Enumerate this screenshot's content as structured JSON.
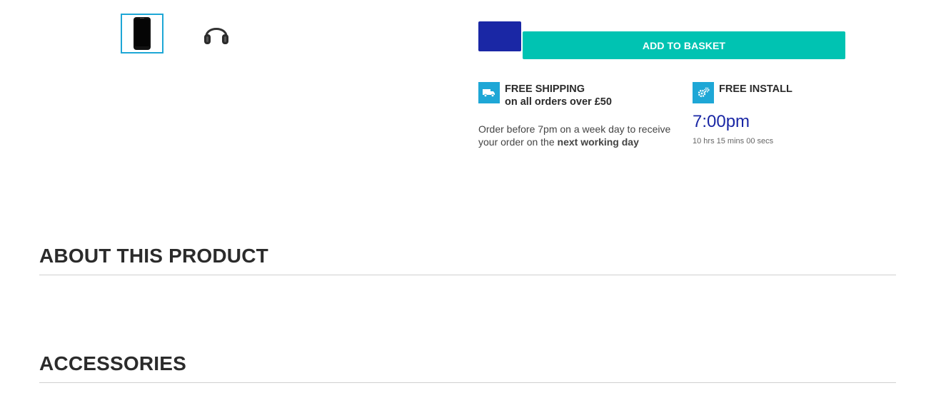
{
  "actions": {
    "add_to_basket_label": "ADD TO BASKET"
  },
  "shipping": {
    "title": "FREE SHIPPING",
    "subtitle": "on all orders over £50",
    "note_prefix": "Order before 7pm on a week day to receive your order on the ",
    "note_bold": "next working day"
  },
  "install": {
    "title": "FREE INSTALL",
    "cutoff_time": "7:00pm",
    "countdown": "10 hrs 15 mins 00 secs"
  },
  "sections": {
    "about_title": "ABOUT THIS PRODUCT",
    "accessories_title": "ACCESSORIES"
  },
  "colors": {
    "accent_teal": "#00c3b2",
    "quantity_blue": "#1a27a5",
    "icon_blue": "#1ea7d6"
  }
}
